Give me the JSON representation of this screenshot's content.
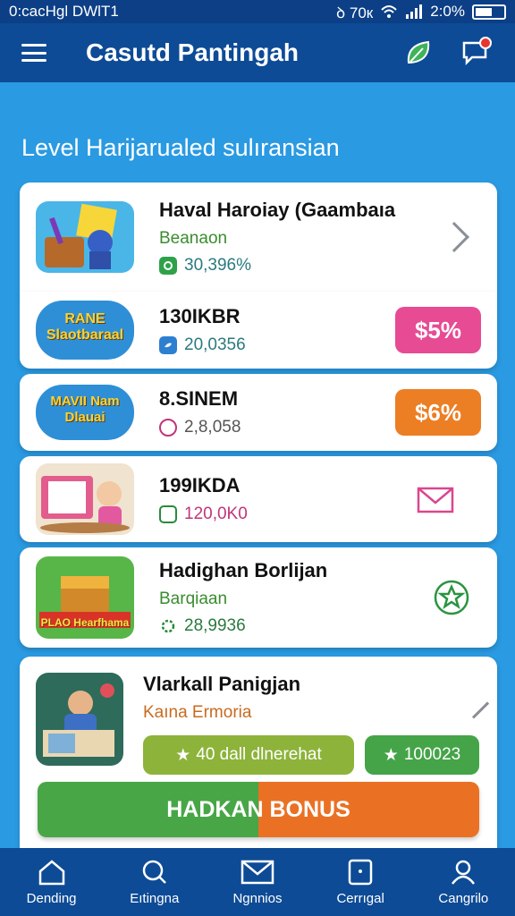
{
  "status": {
    "left": "0:сасНgl DWlT1",
    "right": "ꝺ 70к",
    "time": "2:0%"
  },
  "appbar": {
    "title": "Casutd Pantingah"
  },
  "section_title": "Level Harijarualed sulıransian",
  "cards": [
    {
      "name": "Haval Haroiay (Gaambaıa",
      "sub": "Beanaon",
      "stat": "30,396%"
    },
    {
      "name": "130IKBR",
      "stat": "20,0356",
      "pill": "$5%",
      "thumb_text": "RANE Slaotbaraal"
    },
    {
      "name": "8.SINEM",
      "stat": "2,8,058",
      "pill": "$6%",
      "thumb_text": "MAVII Nam Dlauai"
    },
    {
      "name": "199IKDA",
      "stat": "120,0K0"
    },
    {
      "name": "Hadighan Borlijan",
      "sub": "Barqiaan",
      "stat": "28,9936",
      "thumb_text": "PLAO Hearfhama"
    },
    {
      "name": "Vlarkall Panigjan",
      "sub": "Kaına Ermoria",
      "chip1": "40 dall dlnerehat",
      "chip2": "100023"
    }
  ],
  "bonus_button": "HADKAN BONUS",
  "nav": [
    {
      "label": "Dending",
      "icon": "home-icon"
    },
    {
      "label": "Eıtingna",
      "icon": "search-icon"
    },
    {
      "label": "Ngnnios",
      "icon": "mail-icon"
    },
    {
      "label": "Cerrıgal",
      "icon": "tablet-icon"
    },
    {
      "label": "Cangrilo",
      "icon": "profile-icon"
    }
  ],
  "colors": {
    "header": "#0d4b96",
    "background": "#2a9ae2",
    "pink_pill": "#e74b93",
    "orange_pill": "#ec7e24",
    "green": "#48a647"
  }
}
